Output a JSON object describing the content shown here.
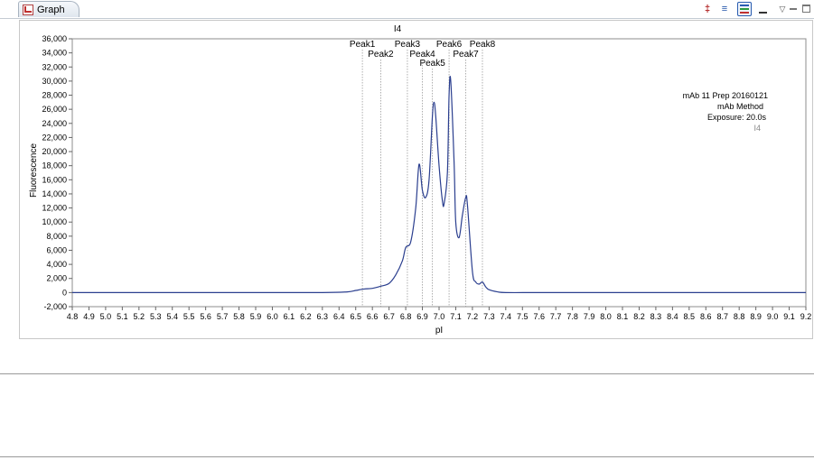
{
  "tab": {
    "label": "Graph"
  },
  "chart_data": {
    "type": "line",
    "title": "I4",
    "xlabel": "pI",
    "ylabel": "Fluorescence",
    "xlim": [
      4.8,
      9.2
    ],
    "ylim": [
      -2000,
      36000
    ],
    "x_ticks": [
      "4.8",
      "4.9",
      "5.0",
      "5.1",
      "5.2",
      "5.3",
      "5.4",
      "5.5",
      "5.6",
      "5.7",
      "5.8",
      "5.9",
      "6.0",
      "6.1",
      "6.2",
      "6.3",
      "6.4",
      "6.5",
      "6.6",
      "6.7",
      "6.8",
      "6.9",
      "7.0",
      "7.1",
      "7.2",
      "7.3",
      "7.4",
      "7.5",
      "7.6",
      "7.7",
      "7.8",
      "7.9",
      "8.0",
      "8.1",
      "8.2",
      "8.3",
      "8.4",
      "8.5",
      "8.6",
      "8.7",
      "8.8",
      "8.9",
      "9.0",
      "9.1",
      "9.2"
    ],
    "y_ticks": [
      "-2,000",
      "0",
      "2,000",
      "4,000",
      "6,000",
      "8,000",
      "10,000",
      "12,000",
      "14,000",
      "16,000",
      "18,000",
      "20,000",
      "22,000",
      "24,000",
      "26,000",
      "28,000",
      "30,000",
      "32,000",
      "34,000",
      "36,000"
    ],
    "grid": false,
    "series_color": "#2b3f8f",
    "peak_line_color": "#9a9a9a",
    "annotations": {
      "sample": "mAb 11 Prep 20160121",
      "method": "mAb Method",
      "exposure": "Exposure: 20.0s",
      "trace": "I4"
    },
    "peaks": [
      {
        "label": "Peak1",
        "x": 6.54,
        "row": 0
      },
      {
        "label": "Peak2",
        "x": 6.65,
        "row": 1
      },
      {
        "label": "Peak3",
        "x": 6.81,
        "row": 0
      },
      {
        "label": "Peak4",
        "x": 6.9,
        "row": 1
      },
      {
        "label": "Peak5",
        "x": 6.96,
        "row": 2
      },
      {
        "label": "Peak6",
        "x": 7.06,
        "row": 0
      },
      {
        "label": "Peak7",
        "x": 7.16,
        "row": 1
      },
      {
        "label": "Peak8",
        "x": 7.26,
        "row": 0
      }
    ],
    "x": [
      4.8,
      5.0,
      5.5,
      6.0,
      6.3,
      6.45,
      6.5,
      6.55,
      6.6,
      6.65,
      6.7,
      6.74,
      6.78,
      6.8,
      6.83,
      6.86,
      6.88,
      6.9,
      6.92,
      6.94,
      6.96,
      6.97,
      6.98,
      7.0,
      7.02,
      7.03,
      7.05,
      7.06,
      7.07,
      7.09,
      7.1,
      7.12,
      7.14,
      7.16,
      7.17,
      7.2,
      7.22,
      7.24,
      7.26,
      7.28,
      7.3,
      7.35,
      7.4,
      7.6,
      8.0,
      8.5,
      9.0,
      9.2
    ],
    "y": [
      0,
      0,
      0,
      0,
      0,
      100,
      300,
      500,
      600,
      900,
      1300,
      2500,
      4500,
      6400,
      7200,
      12000,
      18200,
      14500,
      13500,
      16000,
      25000,
      27000,
      25000,
      18000,
      13000,
      12600,
      17000,
      28000,
      30000,
      18500,
      10000,
      7800,
      11000,
      13500,
      12500,
      3000,
      1500,
      1200,
      1500,
      800,
      400,
      100,
      0,
      0,
      0,
      0,
      0,
      0
    ]
  }
}
